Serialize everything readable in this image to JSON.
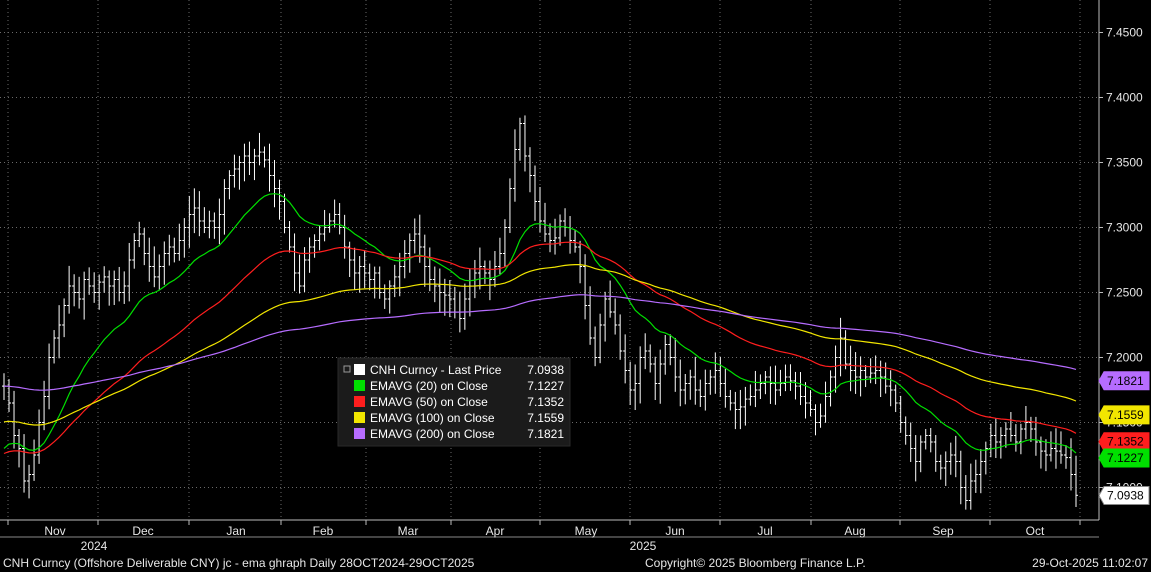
{
  "chart_data": {
    "type": "line",
    "ylim": [
      7.075,
      7.475
    ],
    "yticks": [
      7.1,
      7.15,
      7.2,
      7.25,
      7.3,
      7.35,
      7.4,
      7.45
    ],
    "ytick_labels": [
      "7.1000",
      "7.1500",
      "7.2000",
      "7.2500",
      "7.3000",
      "7.3500",
      "7.4000",
      "7.4500"
    ],
    "grid": true,
    "x_months": [
      "Nov",
      "Dec",
      "Jan",
      "Feb",
      "Mar",
      "Apr",
      "May",
      "Jun",
      "Jul",
      "Aug",
      "Sep",
      "Oct"
    ],
    "x_years": [
      "2024",
      "2025"
    ],
    "price_bars": {
      "name": "CNH Curncy - Last Price",
      "color": "#ffffff",
      "close": [
        7.178,
        7.165,
        7.14,
        7.13,
        7.105,
        7.11,
        7.125,
        7.15,
        7.17,
        7.2,
        7.215,
        7.225,
        7.24,
        7.255,
        7.25,
        7.245,
        7.26,
        7.255,
        7.25,
        7.258,
        7.262,
        7.255,
        7.26,
        7.25,
        7.255,
        7.275,
        7.29,
        7.295,
        7.28,
        7.27,
        7.262,
        7.27,
        7.28,
        7.285,
        7.28,
        7.29,
        7.3,
        7.31,
        7.315,
        7.305,
        7.3,
        7.305,
        7.3,
        7.31,
        7.33,
        7.34,
        7.345,
        7.35,
        7.355,
        7.35,
        7.355,
        7.358,
        7.352,
        7.34,
        7.33,
        7.32,
        7.3,
        7.285,
        7.265,
        7.255,
        7.275,
        7.285,
        7.29,
        7.295,
        7.3,
        7.305,
        7.31,
        7.3,
        7.285,
        7.275,
        7.265,
        7.27,
        7.265,
        7.26,
        7.265,
        7.25,
        7.245,
        7.255,
        7.262,
        7.27,
        7.28,
        7.29,
        7.295,
        7.285,
        7.27,
        7.26,
        7.255,
        7.25,
        7.248,
        7.245,
        7.235,
        7.23,
        7.245,
        7.255,
        7.265,
        7.27,
        7.265,
        7.26,
        7.27,
        7.28,
        7.3,
        7.33,
        7.36,
        7.38,
        7.355,
        7.34,
        7.32,
        7.305,
        7.295,
        7.29,
        7.292,
        7.305,
        7.3,
        7.29,
        7.285,
        7.27,
        7.24,
        7.215,
        7.2,
        7.225,
        7.245,
        7.235,
        7.225,
        7.205,
        7.19,
        7.175,
        7.18,
        7.2,
        7.205,
        7.195,
        7.18,
        7.195,
        7.21,
        7.2,
        7.185,
        7.175,
        7.18,
        7.185,
        7.175,
        7.17,
        7.18,
        7.185,
        7.19,
        7.18,
        7.17,
        7.165,
        7.16,
        7.162,
        7.168,
        7.17,
        7.175,
        7.18,
        7.185,
        7.18,
        7.175,
        7.18,
        7.185,
        7.182,
        7.178,
        7.17,
        7.165,
        7.16,
        7.15,
        7.155,
        7.17,
        7.185,
        7.2,
        7.215,
        7.195,
        7.19,
        7.185,
        7.19,
        7.185,
        7.188,
        7.19,
        7.185,
        7.178,
        7.175,
        7.165,
        7.15,
        7.14,
        7.13,
        7.12,
        7.135,
        7.14,
        7.135,
        7.12,
        7.115,
        7.12,
        7.125,
        7.12,
        7.1,
        7.09,
        7.105,
        7.11,
        7.12,
        7.13,
        7.14,
        7.135,
        7.14,
        7.145,
        7.14,
        7.135,
        7.145,
        7.15,
        7.145,
        7.135,
        7.128,
        7.125,
        7.13,
        7.128,
        7.125,
        7.123,
        7.11,
        7.094
      ]
    },
    "series": [
      {
        "name": "EMAVG (20)  on Close",
        "color": "#00e000",
        "last": 7.1227
      },
      {
        "name": "EMAVG (50)  on Close",
        "color": "#ff1e1e",
        "last": 7.1352
      },
      {
        "name": "EMAVG (100)  on Close",
        "color": "#f2e600",
        "last": 7.1559
      },
      {
        "name": "EMAVG (200)  on Close",
        "color": "#b66cff",
        "last": 7.1821
      }
    ],
    "legend": {
      "placement": "center",
      "rows": [
        {
          "label": "CNH Curncy - Last Price",
          "value": "7.0938",
          "color": "#ffffff"
        },
        {
          "label": "EMAVG (20)  on Close",
          "value": "7.1227",
          "color": "#00e000"
        },
        {
          "label": "EMAVG (50)  on Close",
          "value": "7.1352",
          "color": "#ff1e1e"
        },
        {
          "label": "EMAVG (100)  on Close",
          "value": "7.1559",
          "color": "#f2e600"
        },
        {
          "label": "EMAVG (200)  on Close",
          "value": "7.1821",
          "color": "#b66cff"
        }
      ]
    },
    "last_value_tags": [
      {
        "value": 7.1821,
        "label": "7.1821",
        "color": "#b66cff"
      },
      {
        "value": 7.1559,
        "label": "7.1559",
        "color": "#f2e600"
      },
      {
        "value": 7.1352,
        "label": "7.1352",
        "color": "#ff1e1e"
      },
      {
        "value": 7.1227,
        "label": "7.1227",
        "color": "#00e000"
      },
      {
        "value": 7.0938,
        "label": "7.0938",
        "color": "#ffffff"
      }
    ]
  },
  "footer": {
    "left": "CNH Curncy (Offshore Deliverable CNY) jc - ema ghraph Daily 28OCT2024-29OCT2025",
    "center": "Copyright© 2025 Bloomberg Finance L.P.",
    "right": "29-Oct-2025 11:02:07"
  }
}
